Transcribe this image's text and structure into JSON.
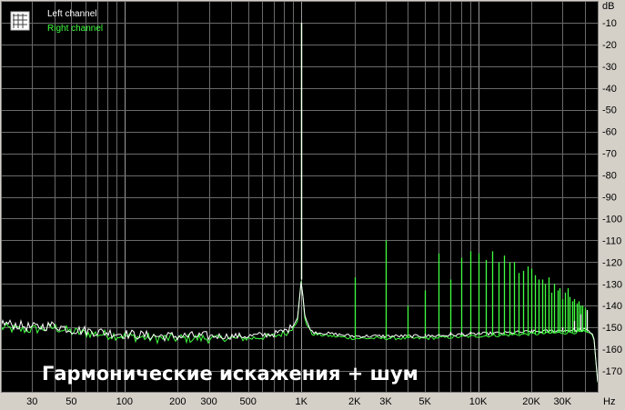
{
  "chart_data": {
    "type": "line",
    "caption": "Гармонические искажения + шум",
    "x_unit": "Hz",
    "y_unit": "dB",
    "xscale": "log",
    "xlim": [
      20,
      48000
    ],
    "ylim": [
      -180,
      0
    ],
    "x_ticks": [
      {
        "value": 30,
        "label": "30"
      },
      {
        "value": 50,
        "label": "50"
      },
      {
        "value": 100,
        "label": "100"
      },
      {
        "value": 200,
        "label": "200"
      },
      {
        "value": 300,
        "label": "300"
      },
      {
        "value": 500,
        "label": "500"
      },
      {
        "value": 1000,
        "label": "1K"
      },
      {
        "value": 2000,
        "label": "2K"
      },
      {
        "value": 3000,
        "label": "3K"
      },
      {
        "value": 5000,
        "label": "5K"
      },
      {
        "value": 10000,
        "label": "10K"
      },
      {
        "value": 20000,
        "label": "20K"
      },
      {
        "value": 30000,
        "label": "30K"
      }
    ],
    "y_ticks": [
      -10,
      -20,
      -30,
      -40,
      -50,
      -60,
      -70,
      -80,
      -90,
      -100,
      -110,
      -120,
      -130,
      -140,
      -150,
      -160,
      -170
    ],
    "grid": true,
    "legend_position": "top-left",
    "series": [
      {
        "name": "Left channel",
        "color": "#ffffff",
        "noise_floor": [
          [
            20,
            -148
          ],
          [
            25,
            -149
          ],
          [
            30,
            -150
          ],
          [
            40,
            -149
          ],
          [
            50,
            -151
          ],
          [
            70,
            -152
          ],
          [
            100,
            -153
          ],
          [
            150,
            -154
          ],
          [
            200,
            -154
          ],
          [
            300,
            -154
          ],
          [
            500,
            -154
          ],
          [
            700,
            -153
          ],
          [
            850,
            -151
          ],
          [
            950,
            -146
          ],
          [
            1000,
            -128
          ],
          [
            1050,
            -146
          ],
          [
            1150,
            -152
          ],
          [
            1500,
            -153
          ],
          [
            2000,
            -154
          ],
          [
            5000,
            -154
          ],
          [
            10000,
            -153
          ],
          [
            20000,
            -152
          ],
          [
            40000,
            -151
          ],
          [
            45000,
            -153
          ],
          [
            48000,
            -180
          ]
        ],
        "peaks": [
          [
            1000,
            -10
          ],
          [
            2000,
            -154
          ],
          [
            3000,
            -154
          ],
          [
            4000,
            -154
          ],
          [
            5000,
            -153
          ],
          [
            6000,
            -153
          ],
          [
            7000,
            -152
          ],
          [
            8000,
            -152
          ],
          [
            9000,
            -152
          ],
          [
            10000,
            -152
          ],
          [
            20000,
            -151
          ],
          [
            30000,
            -150
          ],
          [
            35000,
            -147
          ],
          [
            38000,
            -144
          ],
          [
            41000,
            -142
          ]
        ]
      },
      {
        "name": "Right channel",
        "color": "#40ff40",
        "noise_floor": [
          [
            20,
            -150
          ],
          [
            25,
            -151
          ],
          [
            30,
            -151
          ],
          [
            40,
            -150
          ],
          [
            50,
            -152
          ],
          [
            70,
            -153
          ],
          [
            100,
            -154
          ],
          [
            150,
            -155
          ],
          [
            200,
            -155
          ],
          [
            300,
            -155
          ],
          [
            500,
            -155
          ],
          [
            700,
            -154
          ],
          [
            850,
            -152
          ],
          [
            950,
            -147
          ],
          [
            1000,
            -128
          ],
          [
            1050,
            -147
          ],
          [
            1150,
            -153
          ],
          [
            1500,
            -154
          ],
          [
            2000,
            -155
          ],
          [
            5000,
            -155
          ],
          [
            10000,
            -154
          ],
          [
            20000,
            -153
          ],
          [
            40000,
            -152
          ],
          [
            45000,
            -154
          ],
          [
            48000,
            -180
          ]
        ],
        "peaks": [
          [
            1000,
            -10
          ],
          [
            2000,
            -127
          ],
          [
            3000,
            -110
          ],
          [
            4000,
            -140
          ],
          [
            5000,
            -133
          ],
          [
            6000,
            -116
          ],
          [
            7000,
            -128
          ],
          [
            8000,
            -118
          ],
          [
            9000,
            -115
          ],
          [
            10000,
            -116
          ],
          [
            11000,
            -119
          ],
          [
            12000,
            -115
          ],
          [
            13000,
            -120
          ],
          [
            14000,
            -117
          ],
          [
            15000,
            -120
          ],
          [
            16000,
            -120
          ],
          [
            17000,
            -125
          ],
          [
            18000,
            -124
          ],
          [
            19000,
            -122
          ],
          [
            20000,
            -123
          ],
          [
            21000,
            -126
          ],
          [
            22000,
            -128
          ],
          [
            23000,
            -128
          ],
          [
            24000,
            -130
          ],
          [
            25000,
            -127
          ],
          [
            26000,
            -134
          ],
          [
            27000,
            -130
          ],
          [
            28000,
            -133
          ],
          [
            29000,
            -132
          ],
          [
            30000,
            -137
          ],
          [
            31000,
            -134
          ],
          [
            32000,
            -132
          ],
          [
            33000,
            -136
          ],
          [
            34000,
            -138
          ],
          [
            35000,
            -137
          ],
          [
            36000,
            -139
          ],
          [
            37000,
            -138
          ],
          [
            38000,
            -140
          ],
          [
            39000,
            -140
          ],
          [
            40000,
            -141
          ],
          [
            41000,
            -143
          ]
        ]
      }
    ]
  }
}
